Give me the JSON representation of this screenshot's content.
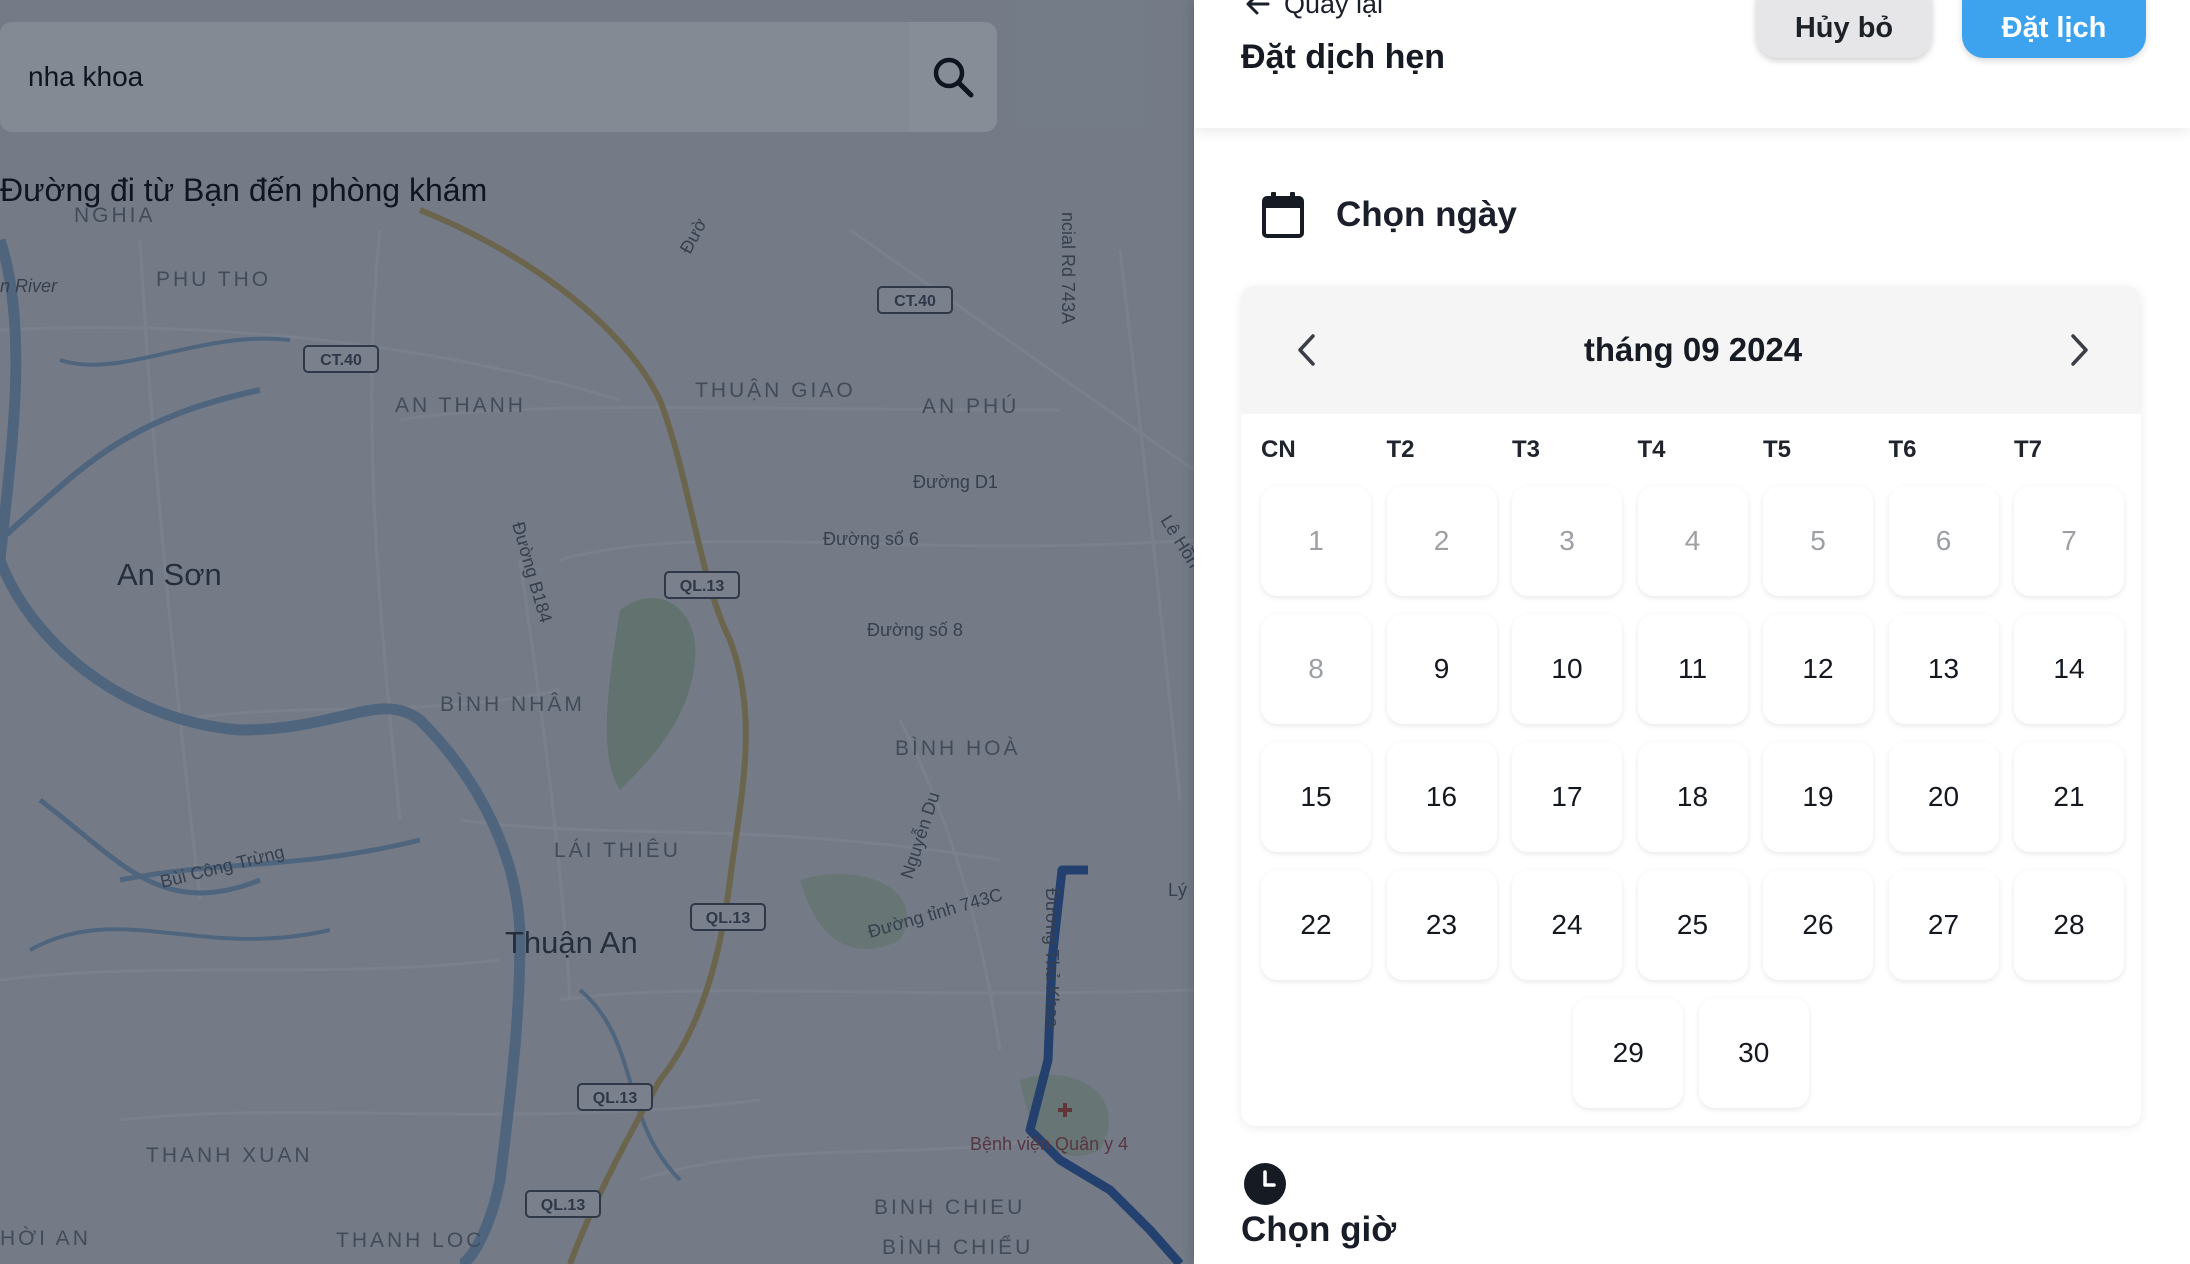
{
  "search": {
    "value": "nha khoa",
    "icon": "search-icon"
  },
  "map": {
    "route_caption": "Đường đi từ Bạn đến phòng khám",
    "places": {
      "nghia": "NGHIA",
      "river": "n River",
      "phu_tho": "PHU THO",
      "an_thanh": "AN THANH",
      "thuan_giao": "THUẬN GIAO",
      "an_phu": "AN PHÚ",
      "an_son": "An Sơn",
      "binh_nham": "BÌNH NHÂM",
      "binh_hoa": "BÌNH HOÀ",
      "lai_thieu": "LÁI THIÊU",
      "thuan_an": "Thuận An",
      "thanh_xuan": "THANH XUAN",
      "thanh_loc": "THANH LOC",
      "hoi_an": "HỜI AN",
      "binh_chieu_1": "BINH CHIEU",
      "binh_chieu_2": "BÌNH CHIỂU",
      "hospital": "Bệnh viện Quân y 4"
    },
    "streets": {
      "duong_top": "Đườ",
      "rd_743a": "ncial Rd 743A",
      "duong_d1": "Đường D1",
      "duong_so6": "Đường số 6",
      "duong_so8": "Đường số 8",
      "duong_b184": "Đường B184",
      "le_hong": "Lê Hồn",
      "nguyen_du": "Nguyễn Du",
      "bui_cong_trung": "Bùi Công Trừng",
      "duong_743c": "Đường tỉnh 743C",
      "ly": "Lý",
      "duong_vertical": "Đường Thủ Khoa"
    },
    "shields": {
      "ct40_a": "CT.40",
      "ct40_b": "CT.40",
      "ql13_a": "QL.13",
      "ql13_b": "QL.13",
      "ql13_c": "QL.13",
      "ql13_d": "QL.13"
    },
    "colors": {
      "water": "#8fb5d9",
      "highway": "#d9b65c",
      "route": "#1b56b4",
      "hospital": "#c0392b"
    }
  },
  "header": {
    "back_label": "Quay lại",
    "title": "Đặt dịch hẹn",
    "cancel_label": "Hủy bỏ",
    "book_label": "Đặt lịch"
  },
  "date_section": {
    "title": "Chọn ngày",
    "icon": "calendar-icon"
  },
  "calendar": {
    "month_label": "tháng 09 2024",
    "weekdays": [
      "CN",
      "T2",
      "T3",
      "T4",
      "T5",
      "T6",
      "T7"
    ],
    "days": [
      "1",
      "2",
      "3",
      "4",
      "5",
      "6",
      "7",
      "8",
      "9",
      "10",
      "11",
      "12",
      "13",
      "14",
      "15",
      "16",
      "17",
      "18",
      "19",
      "20",
      "21",
      "22",
      "23",
      "24",
      "25",
      "26",
      "27",
      "28",
      "29",
      "30"
    ],
    "disabled_days": [
      "1",
      "2",
      "3",
      "4",
      "5",
      "6",
      "7",
      "8"
    ]
  },
  "time_section": {
    "title": "Chọn giờ",
    "icon": "clock-icon"
  },
  "colors": {
    "primary": "#3ea3ee",
    "cancel_bg": "#e6e6e8",
    "disabled_text": "#9c9fa4"
  }
}
